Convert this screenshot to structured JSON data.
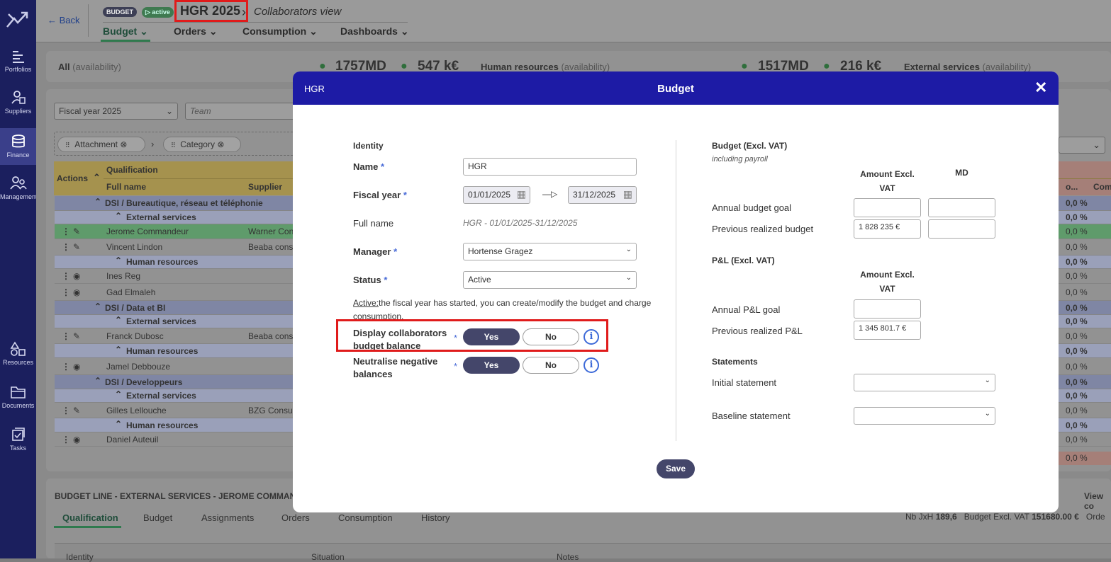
{
  "rail": {
    "items": [
      {
        "label": "Portfolios",
        "icon": "portfolios-icon"
      },
      {
        "label": "Suppliers",
        "icon": "suppliers-icon"
      },
      {
        "label": "Finance",
        "icon": "finance-icon"
      },
      {
        "label": "Management",
        "icon": "management-icon"
      },
      {
        "label": "Resources",
        "icon": "resources-icon"
      },
      {
        "label": "Documents",
        "icon": "documents-icon"
      },
      {
        "label": "Tasks",
        "icon": "tasks-icon"
      }
    ]
  },
  "header": {
    "back": "← Back",
    "badge_budget": "BUDGET",
    "badge_active": "▷ active",
    "title": "HGR 2025",
    "subtitle": "Collaborators view",
    "tabs": [
      "Budget",
      "Orders",
      "Consumption",
      "Dashboards"
    ]
  },
  "summary": {
    "all_label": "All",
    "all_suffix": "(availability)",
    "md1": "1757MD",
    "k1": "547 k€",
    "hr_label": "Human resources",
    "hr_suffix": "(availability)",
    "md2": "1517MD",
    "k2": "216 k€",
    "ext_label": "External services",
    "ext_suffix": "(availability)"
  },
  "filters": {
    "fiscal_year": "Fiscal year 2025",
    "team_placeholder": "Team",
    "chip1": "Attachment",
    "chip2": "Category"
  },
  "table": {
    "col_actions": "Actions",
    "col_qualification": "Qualification",
    "col_full_name": "Full name",
    "col_supplier": "Supplier",
    "col_o": "o...",
    "col_com": "Com",
    "rows": [
      {
        "type": "group",
        "text": "DSI / Bureautique, réseau et téléphonie",
        "pct": "0,0 %"
      },
      {
        "type": "sub",
        "text": "External services",
        "pct": "0,0 %"
      },
      {
        "type": "sel",
        "name": "Jerome Commandeur",
        "supplier": "Warner Con",
        "pct": "0,0 %"
      },
      {
        "type": "item",
        "name": "Vincent Lindon",
        "supplier": "Beaba cons",
        "pct": "0,0 %"
      },
      {
        "type": "sub",
        "text": "Human resources",
        "pct": "0,0 %"
      },
      {
        "type": "item",
        "name": "Ines Reg",
        "supplier": "",
        "pct": "0,0 %"
      },
      {
        "type": "item",
        "name": "Gad Elmaleh",
        "supplier": "",
        "pct": "0,0 %"
      },
      {
        "type": "group",
        "text": "DSI / Data et BI",
        "pct": "0,0 %"
      },
      {
        "type": "sub",
        "text": "External services",
        "pct": "0,0 %"
      },
      {
        "type": "item",
        "name": "Franck Dubosc",
        "supplier": "Beaba cons",
        "pct": "0,0 %"
      },
      {
        "type": "sub",
        "text": "Human resources",
        "pct": "0,0 %"
      },
      {
        "type": "item",
        "name": "Jamel Debbouze",
        "supplier": "",
        "pct": "0,0 %"
      },
      {
        "type": "group",
        "text": "DSI / Developpeurs",
        "pct": "0,0 %"
      },
      {
        "type": "sub",
        "text": "External services",
        "pct": "0,0 %"
      },
      {
        "type": "item",
        "name": "Gilles Lellouche",
        "supplier": "BZG Consul",
        "pct": "0,0 %"
      },
      {
        "type": "sub",
        "text": "Human resources",
        "pct": "0,0 %"
      },
      {
        "type": "item",
        "name": "Daniel Auteuil",
        "supplier": "",
        "pct": "0,0 %"
      }
    ],
    "total_pct": "0,0 %"
  },
  "bottom": {
    "title": "BUDGET LINE - EXTERNAL SERVICES - JEROME COMMANDEUR",
    "tabs": [
      "Qualification",
      "Budget",
      "Assignments",
      "Orders",
      "Consumption",
      "History"
    ],
    "view_co": "View co",
    "nb_jxh_label": "Nb JxH",
    "nb_jxh": "189,6",
    "budget_excl_label": "Budget Excl. VAT",
    "budget_excl": "151680.00 €",
    "orde": "Orde",
    "col_identity": "Identity",
    "col_situation": "Situation",
    "col_notes": "Notes"
  },
  "modal": {
    "head_left": "HGR",
    "head_title": "Budget",
    "close": "✕",
    "identity_title": "Identity",
    "name_label": "Name",
    "name_value": "HGR",
    "fiscal_year_label": "Fiscal year",
    "fy_start": "01/01/2025",
    "fy_arrow": "—▷",
    "fy_end": "31/12/2025",
    "full_name_label": "Full name",
    "full_name_value": "HGR - 01/01/2025-31/12/2025",
    "manager_label": "Manager",
    "manager_value": "Hortense Gragez",
    "status_label": "Status",
    "status_value": "Active",
    "status_note_link": "Active:",
    "status_note": "the fiscal year has started, you can create/modify the budget and charge consumption.",
    "display_label": "Display collaborators budget balance",
    "neutralise_label": "Neutralise negative balances",
    "yes": "Yes",
    "no": "No",
    "budget_title": "Budget (Excl. VAT)",
    "budget_sub": "including payroll",
    "amount_col": "Amount Excl. VAT",
    "md_col": "MD",
    "annual_budget_goal": "Annual budget goal",
    "prev_realized_budget": "Previous realized budget",
    "prev_realized_budget_value": "1 828 235 €",
    "pl_title": "P&L (Excl. VAT)",
    "annual_pl_goal": "Annual P&L goal",
    "prev_realized_pl": "Previous realized P&L",
    "prev_realized_pl_value": "1 345 801.7 €",
    "statements_title": "Statements",
    "initial_statement": "Initial statement",
    "baseline_statement": "Baseline statement",
    "save": "Save"
  }
}
